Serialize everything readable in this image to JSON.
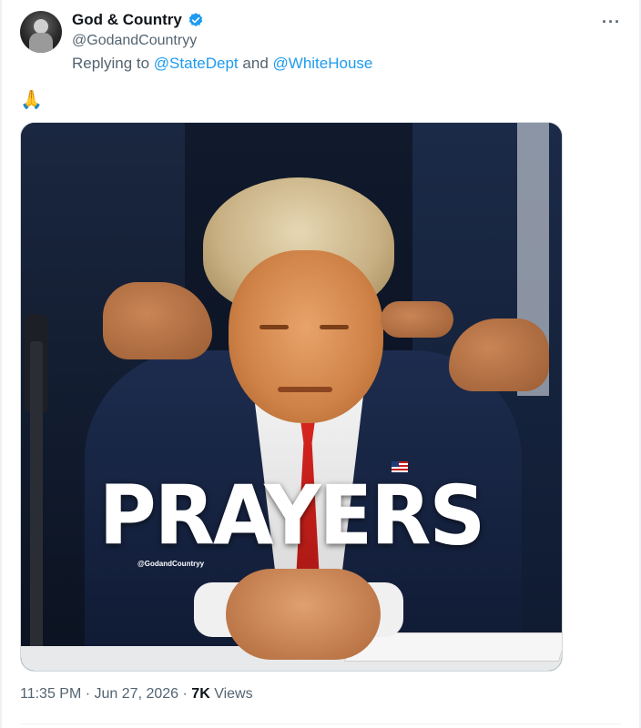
{
  "account": {
    "display_name": "God & Country",
    "handle": "@GodandCountryy",
    "verified_color": "#1d9bf0"
  },
  "reply": {
    "prefix": "Replying to",
    "mention1": "@StateDept",
    "joiner": "and",
    "mention2": "@WhiteHouse"
  },
  "tweet": {
    "text": "🙏"
  },
  "media": {
    "overlay_text": "PRAYERS",
    "watermark": "@GodandCountryy"
  },
  "meta": {
    "time": "11:35 PM",
    "sep1": "·",
    "date": "Jun 27, 2026",
    "sep2": "·",
    "views_count": "7K",
    "views_label": "Views"
  },
  "icons": {
    "more": "more-horizontal-icon",
    "verified": "verified-badge-icon"
  }
}
